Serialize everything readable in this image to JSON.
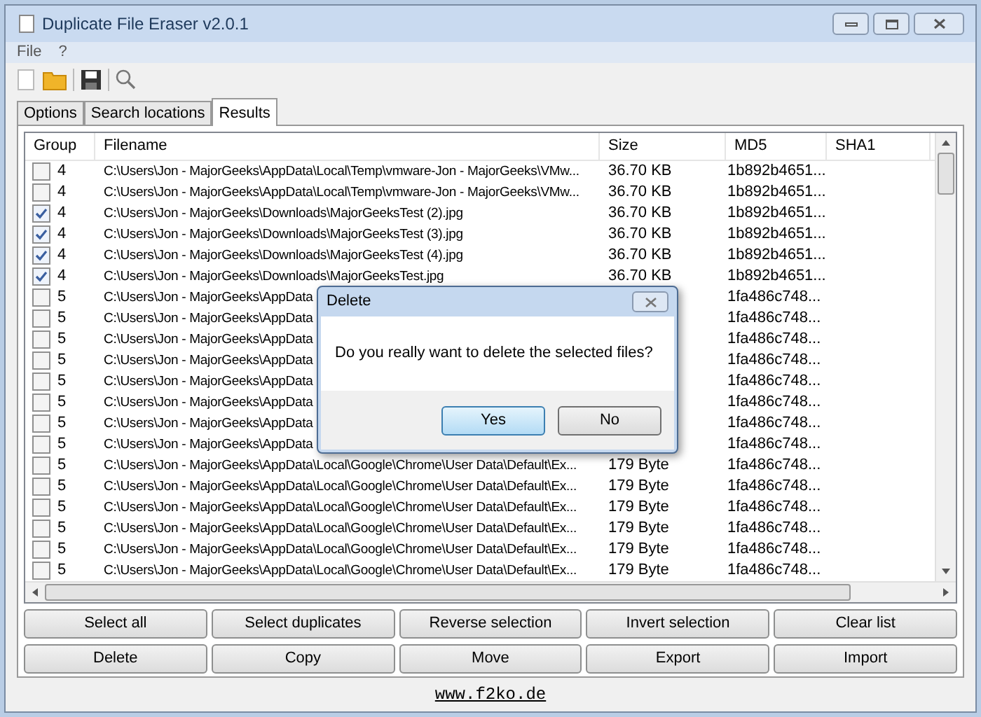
{
  "window": {
    "title": "Duplicate File Eraser v2.0.1"
  },
  "menu": [
    "File",
    "?"
  ],
  "tabs": [
    {
      "label": "Options",
      "selected": false
    },
    {
      "label": "Search locations",
      "selected": false
    },
    {
      "label": "Results",
      "selected": true
    }
  ],
  "table": {
    "columns": [
      "Group",
      "Filename",
      "Size",
      "MD5",
      "SHA1"
    ],
    "rows": [
      {
        "checked": false,
        "group": "4",
        "filename": "C:\\Users\\Jon - MajorGeeks\\AppData\\Local\\Temp\\vmware-Jon - MajorGeeks\\VMw...",
        "size": "36.70 KB",
        "md5": "1b892b4651..."
      },
      {
        "checked": false,
        "group": "4",
        "filename": "C:\\Users\\Jon - MajorGeeks\\AppData\\Local\\Temp\\vmware-Jon - MajorGeeks\\VMw...",
        "size": "36.70 KB",
        "md5": "1b892b4651..."
      },
      {
        "checked": true,
        "group": "4",
        "filename": "C:\\Users\\Jon - MajorGeeks\\Downloads\\MajorGeeksTest (2).jpg",
        "size": "36.70 KB",
        "md5": "1b892b4651..."
      },
      {
        "checked": true,
        "group": "4",
        "filename": "C:\\Users\\Jon - MajorGeeks\\Downloads\\MajorGeeksTest (3).jpg",
        "size": "36.70 KB",
        "md5": "1b892b4651..."
      },
      {
        "checked": true,
        "group": "4",
        "filename": "C:\\Users\\Jon - MajorGeeks\\Downloads\\MajorGeeksTest (4).jpg",
        "size": "36.70 KB",
        "md5": "1b892b4651..."
      },
      {
        "checked": true,
        "group": "4",
        "filename": "C:\\Users\\Jon - MajorGeeks\\Downloads\\MajorGeeksTest.jpg",
        "size": "36.70 KB",
        "md5": "1b892b4651..."
      },
      {
        "checked": false,
        "group": "5",
        "filename": "C:\\Users\\Jon - MajorGeeks\\AppData",
        "md5": "1fa486c748..."
      },
      {
        "checked": false,
        "group": "5",
        "filename": "C:\\Users\\Jon - MajorGeeks\\AppData",
        "md5": "1fa486c748..."
      },
      {
        "checked": false,
        "group": "5",
        "filename": "C:\\Users\\Jon - MajorGeeks\\AppData",
        "md5": "1fa486c748..."
      },
      {
        "checked": false,
        "group": "5",
        "filename": "C:\\Users\\Jon - MajorGeeks\\AppData",
        "md5": "1fa486c748..."
      },
      {
        "checked": false,
        "group": "5",
        "filename": "C:\\Users\\Jon - MajorGeeks\\AppData",
        "md5": "1fa486c748..."
      },
      {
        "checked": false,
        "group": "5",
        "filename": "C:\\Users\\Jon - MajorGeeks\\AppData",
        "md5": "1fa486c748..."
      },
      {
        "checked": false,
        "group": "5",
        "filename": "C:\\Users\\Jon - MajorGeeks\\AppData",
        "md5": "1fa486c748..."
      },
      {
        "checked": false,
        "group": "5",
        "filename": "C:\\Users\\Jon - MajorGeeks\\AppData",
        "md5": "1fa486c748..."
      },
      {
        "checked": false,
        "group": "5",
        "filename": "C:\\Users\\Jon - MajorGeeks\\AppData\\Local\\Google\\Chrome\\User Data\\Default\\Ex...",
        "size": "179 Byte",
        "md5": "1fa486c748..."
      },
      {
        "checked": false,
        "group": "5",
        "filename": "C:\\Users\\Jon - MajorGeeks\\AppData\\Local\\Google\\Chrome\\User Data\\Default\\Ex...",
        "size": "179 Byte",
        "md5": "1fa486c748..."
      },
      {
        "checked": false,
        "group": "5",
        "filename": "C:\\Users\\Jon - MajorGeeks\\AppData\\Local\\Google\\Chrome\\User Data\\Default\\Ex...",
        "size": "179 Byte",
        "md5": "1fa486c748..."
      },
      {
        "checked": false,
        "group": "5",
        "filename": "C:\\Users\\Jon - MajorGeeks\\AppData\\Local\\Google\\Chrome\\User Data\\Default\\Ex...",
        "size": "179 Byte",
        "md5": "1fa486c748..."
      },
      {
        "checked": false,
        "group": "5",
        "filename": "C:\\Users\\Jon - MajorGeeks\\AppData\\Local\\Google\\Chrome\\User Data\\Default\\Ex...",
        "size": "179 Byte",
        "md5": "1fa486c748..."
      },
      {
        "checked": false,
        "group": "5",
        "filename": "C:\\Users\\Jon - MajorGeeks\\AppData\\Local\\Google\\Chrome\\User Data\\Default\\Ex...",
        "size": "179 Byte",
        "md5": "1fa486c748..."
      }
    ]
  },
  "buttons": [
    [
      "Select all",
      "Select duplicates",
      "Reverse selection",
      "Invert selection",
      "Clear list"
    ],
    [
      "Delete",
      "Copy",
      "Move",
      "Export",
      "Import"
    ]
  ],
  "link": "www.f2ko.de",
  "dialog": {
    "title": "Delete",
    "message": "Do you really want to delete the selected files?",
    "buttons": [
      {
        "label": "Yes",
        "selected": true
      },
      {
        "label": "No",
        "selected": false
      }
    ]
  }
}
